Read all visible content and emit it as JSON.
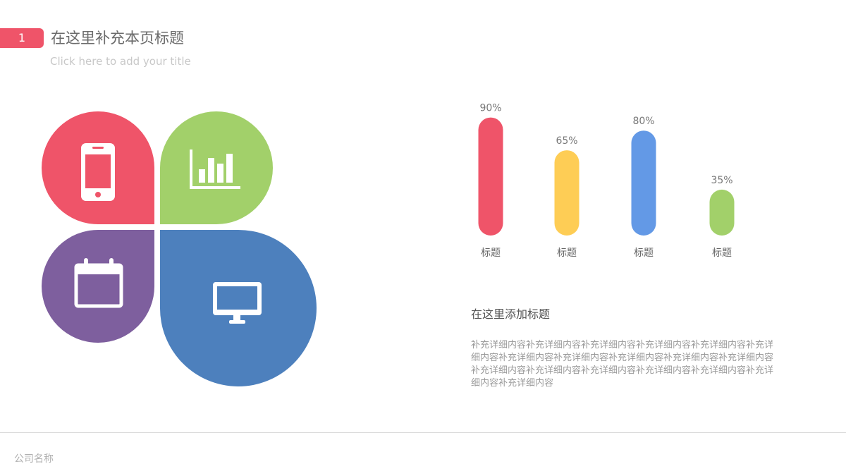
{
  "header": {
    "slide_number": "1",
    "title": "在这里补充本页标题",
    "subtitle": "Click here to add your title"
  },
  "petals": [
    {
      "color": "#ef5469",
      "icon": "smartphone-icon"
    },
    {
      "color": "#a2d06a",
      "icon": "bar-chart-icon"
    },
    {
      "color": "#7e5f9e",
      "icon": "calendar-icon"
    },
    {
      "color": "#4d80bd",
      "icon": "monitor-icon"
    }
  ],
  "chart_data": {
    "type": "bar",
    "categories": [
      "标题",
      "标题",
      "标题",
      "标题"
    ],
    "values": [
      90,
      65,
      80,
      35
    ],
    "value_labels": [
      "90%",
      "65%",
      "80%",
      "35%"
    ],
    "colors": [
      "#ef5469",
      "#fecd55",
      "#6399e6",
      "#a2d06a"
    ],
    "ylim": [
      0,
      100
    ],
    "title": "",
    "xlabel": "",
    "ylabel": "",
    "grid": false
  },
  "section": {
    "heading": "在这里添加标题",
    "body": "补充详细内容补充详细内容补充详细内容补充详细内容补充详细内容补充详细内容补充详细内容补充详细内容补充详细内容补充详细内容补充详细内容补充详细内容补充详细内容补充详细内容补充详细内容补充详细内容补充详细内容补充详细内容"
  },
  "footer": {
    "company": "公司名称"
  }
}
